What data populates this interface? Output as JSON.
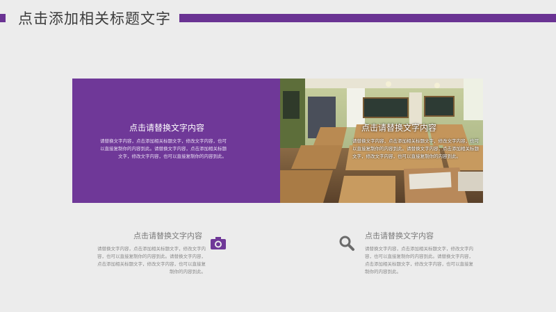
{
  "header": {
    "title": "点击添加相关标题文字",
    "accent_color": "#6a3393"
  },
  "card": {
    "heading": "点击请替换文字内容",
    "body": "请替换文字内容，点击添加相关标题文字，修改文字内容，也可以直接复制你的内容到此。请替换文字内容，点击添加相关标题文字，修改文字内容，也可以直接复制你的内容到此。",
    "background": "#6f3898"
  },
  "photo": {
    "heading": "点击请替换文字内容",
    "body": "请替换文字内容，点击添加相关标题文字，修改文字内容，也可以直接复制你的内容到此。请替换文字内容，点击添加相关标题文字，修改文字内容，也可以直接复制你的内容到此。"
  },
  "features": [
    {
      "heading": "点击请替换文字内容",
      "body": "请替换文字内容，点击添加相关标题文字，修改文字内容，也可以直接复制你的内容到此。请替换文字内容，点击添加相关标题文字，修改文字内容，也可以直接复制你的内容到此。",
      "icon": "camera-icon"
    },
    {
      "heading": "点击请替换文字内容",
      "body": "请替换文字内容，点击添加相关标题文字，修改文字内容，也可以直接复制你的内容到此。请替换文字内容，点击添加相关标题文字，修改文字内容，也可以直接复制你的内容到此。",
      "icon": "search-icon"
    }
  ]
}
